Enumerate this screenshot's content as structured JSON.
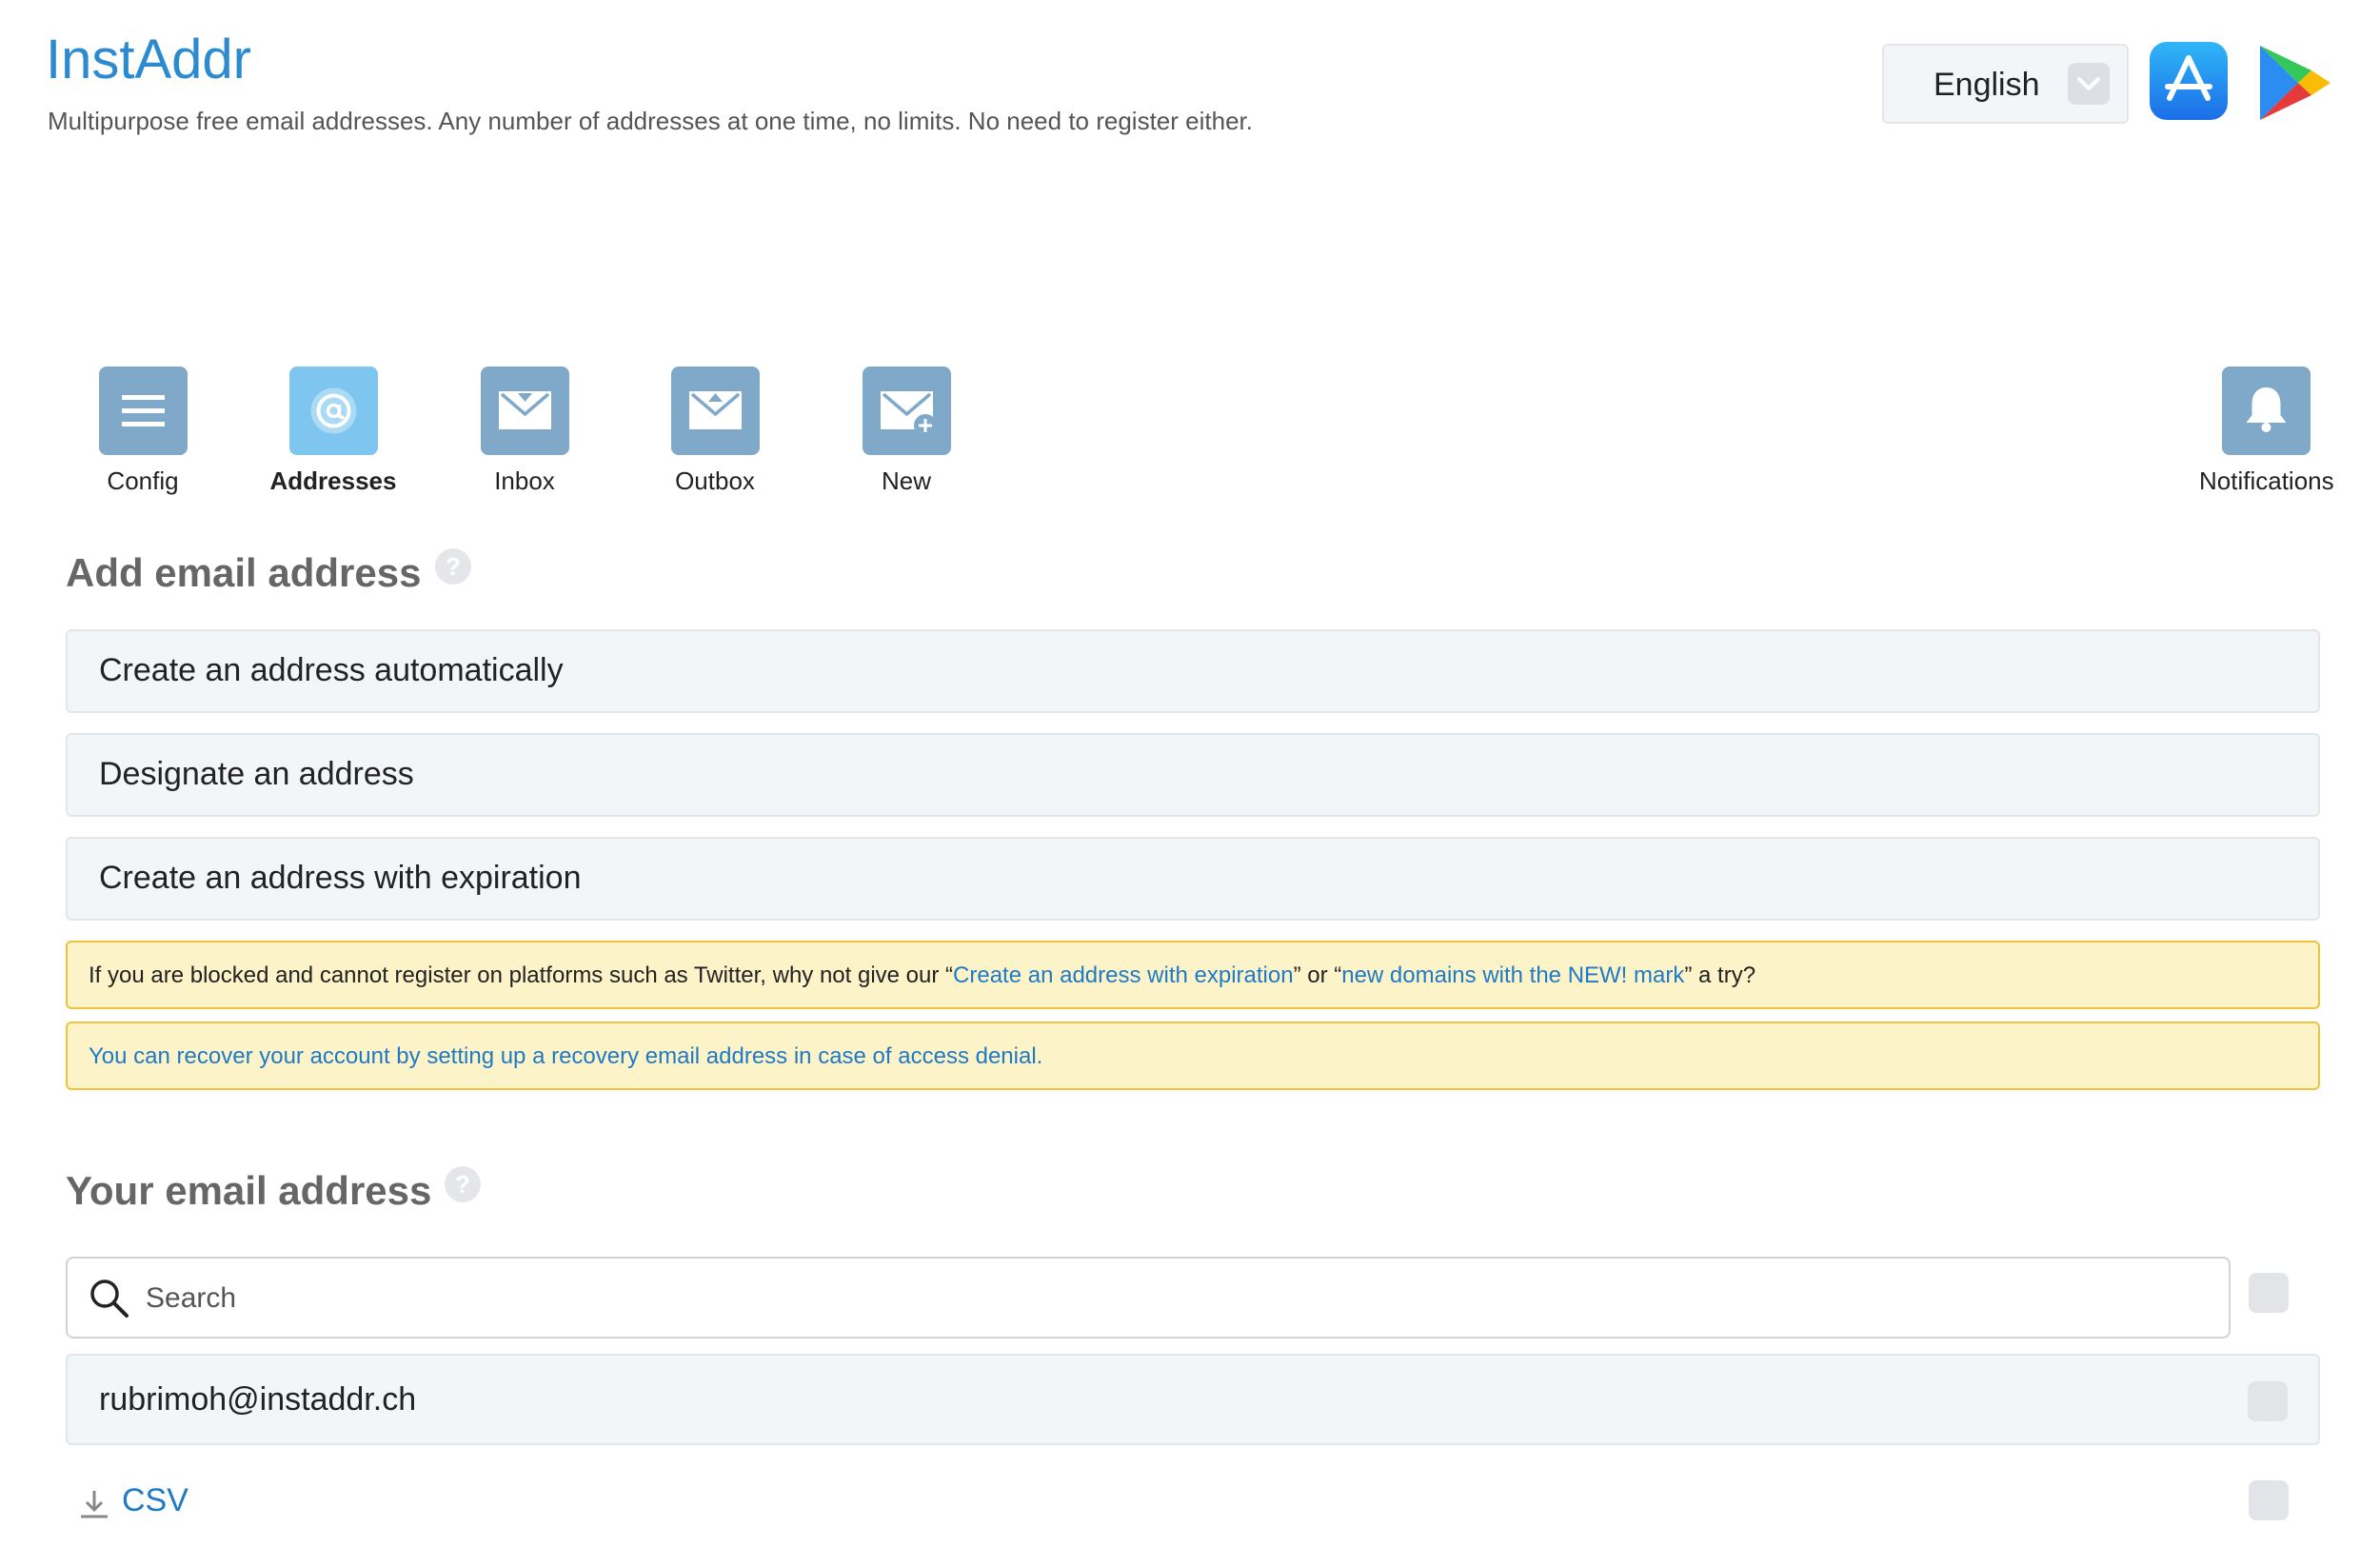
{
  "header": {
    "title": "InstAddr",
    "tagline": "Multipurpose free email addresses. Any number of addresses at one time, no limits. No need to register either.",
    "language": "English",
    "store_icons": [
      "app-store-icon",
      "google-play-icon"
    ]
  },
  "nav": {
    "items": [
      {
        "label": "Config",
        "icon": "menu-icon"
      },
      {
        "label": "Addresses",
        "icon": "at-icon",
        "active": true
      },
      {
        "label": "Inbox",
        "icon": "inbox-mail-icon"
      },
      {
        "label": "Outbox",
        "icon": "outbox-mail-icon"
      },
      {
        "label": "New",
        "icon": "new-mail-icon"
      }
    ],
    "notifications": {
      "label": "Notifications",
      "icon": "bell-icon"
    }
  },
  "add_section": {
    "heading": "Add email address",
    "options": [
      "Create an address automatically",
      "Designate an address",
      "Create an address with expiration"
    ]
  },
  "notices": {
    "blocked": {
      "pre": "If you are blocked and cannot register on platforms such as Twitter, why not give our “",
      "link1": "Create an address with expiration",
      "mid": "” or “",
      "link2": "new domains with the NEW! mark",
      "post": "” a try?"
    },
    "recovery": "You can recover your account by setting up a recovery email address in case of access denial."
  },
  "your_section": {
    "heading": "Your email address",
    "search_placeholder": "Search",
    "addresses": [
      "rubrimoh@instaddr.ch"
    ],
    "csv_label": "CSV"
  },
  "colors": {
    "brand": "#2b8ad0",
    "nav_icon": "#7fa8c9",
    "nav_icon_active": "#7ec6ef",
    "notice_bg": "#fdf3c8",
    "notice_border": "#f0c33c",
    "link": "#1f7ac6"
  }
}
